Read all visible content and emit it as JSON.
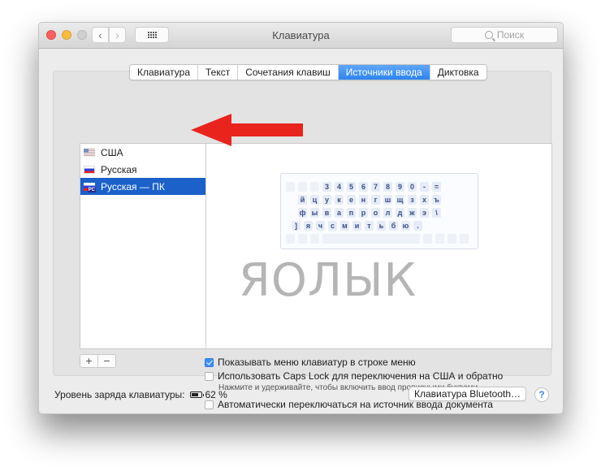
{
  "window": {
    "title": "Клавиатура",
    "search_placeholder": "Поиск",
    "nav_back": "‹",
    "nav_forward": "›"
  },
  "tabs": [
    {
      "label": "Клавиатура",
      "active": false
    },
    {
      "label": "Текст",
      "active": false
    },
    {
      "label": "Сочетания клавиш",
      "active": false
    },
    {
      "label": "Источники ввода",
      "active": true
    },
    {
      "label": "Диктовка",
      "active": false
    }
  ],
  "input_sources": [
    {
      "label": "США",
      "flag": "us-flag",
      "selected": false
    },
    {
      "label": "Русская",
      "flag": "ru-flag",
      "selected": false
    },
    {
      "label": "Русская — ПК",
      "flag": "ru-pc-flag",
      "selected": true,
      "badge": "PC"
    }
  ],
  "keyboard_preview": {
    "rows": [
      [
        "",
        "",
        "",
        "3",
        "4",
        "5",
        "6",
        "7",
        "8",
        "9",
        "0",
        "-",
        "="
      ],
      [
        "й",
        "ц",
        "у",
        "к",
        "е",
        "н",
        "г",
        "ш",
        "щ",
        "з",
        "х",
        "ъ"
      ],
      [
        "ф",
        "ы",
        "в",
        "а",
        "п",
        "р",
        "о",
        "л",
        "д",
        "ж",
        "э",
        "\\"
      ],
      [
        "]",
        "я",
        "ч",
        "с",
        "м",
        "и",
        "т",
        "ь",
        "б",
        "ю",
        "."
      ]
    ]
  },
  "watermark": "ЯОЛЫК",
  "list_controls": {
    "add": "+",
    "remove": "−"
  },
  "options": [
    {
      "label": "Показывать меню клавиатур в строке меню",
      "checked": true
    },
    {
      "label": "Использовать Caps Lock для переключения на США и обратно",
      "checked": false
    },
    {
      "label": "Автоматически переключаться на источник ввода документа",
      "checked": false
    }
  ],
  "caps_hint": "Нажмите и удерживайте, чтобы включить ввод прописными буквами.",
  "battery": {
    "label": "Уровень заряда клавиатуры:",
    "value": "62 %",
    "percent": 62
  },
  "bluetooth_button": "Клавиатура Bluetooth…",
  "help_button": "?",
  "colors": {
    "accent": "#2d84ef",
    "selection": "#1b61c9",
    "annotation_arrow": "#e8241d"
  }
}
